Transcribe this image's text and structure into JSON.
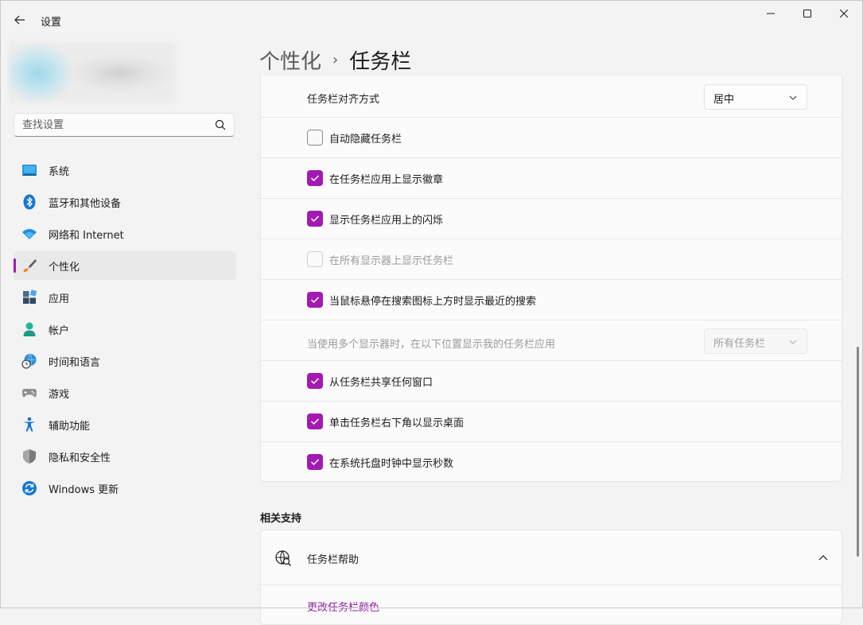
{
  "window": {
    "title": "设置",
    "controls": {
      "minimize": "minimize-icon",
      "maximize": "maximize-icon",
      "close": "close-icon"
    }
  },
  "search": {
    "placeholder": "查找设置"
  },
  "sidebar": {
    "items": [
      {
        "label": "系统",
        "icon": "system-icon"
      },
      {
        "label": "蓝牙和其他设备",
        "icon": "bluetooth-icon"
      },
      {
        "label": "网络和 Internet",
        "icon": "wifi-icon"
      },
      {
        "label": "个性化",
        "icon": "paintbrush-icon",
        "active": true
      },
      {
        "label": "应用",
        "icon": "apps-icon"
      },
      {
        "label": "帐户",
        "icon": "account-icon"
      },
      {
        "label": "时间和语言",
        "icon": "time-language-icon"
      },
      {
        "label": "游戏",
        "icon": "gamepad-icon"
      },
      {
        "label": "辅助功能",
        "icon": "accessibility-icon"
      },
      {
        "label": "隐私和安全性",
        "icon": "shield-icon"
      },
      {
        "label": "Windows 更新",
        "icon": "update-icon"
      }
    ]
  },
  "header": {
    "parent": "个性化",
    "separator": "›",
    "current": "任务栏"
  },
  "settings": {
    "alignment": {
      "label": "任务栏对齐方式",
      "value": "居中"
    },
    "checkboxes": [
      {
        "label": "自动隐藏任务栏",
        "checked": false,
        "disabled": false
      },
      {
        "label": "在任务栏应用上显示徽章",
        "checked": true,
        "disabled": false
      },
      {
        "label": "显示任务栏应用上的闪烁",
        "checked": true,
        "disabled": false
      },
      {
        "label": "在所有显示器上显示任务栏",
        "checked": false,
        "disabled": true
      },
      {
        "label": "当鼠标悬停在搜索图标上方时显示最近的搜索",
        "checked": true,
        "disabled": false
      }
    ],
    "multi_display": {
      "label": "当使用多个显示器时，在以下位置显示我的任务栏应用",
      "value": "所有任务栏",
      "disabled": true
    },
    "checkboxes2": [
      {
        "label": "从任务栏共享任何窗口",
        "checked": true
      },
      {
        "label": "单击任务栏右下角以显示桌面",
        "checked": true
      },
      {
        "label": "在系统托盘时钟中显示秒数",
        "checked": true
      }
    ]
  },
  "related": {
    "title": "相关支持",
    "help": {
      "label": "任务栏帮助",
      "link": "更改任务栏颜色"
    }
  },
  "colors": {
    "accent": "#a21ab1",
    "link": "#8e1a9e"
  }
}
